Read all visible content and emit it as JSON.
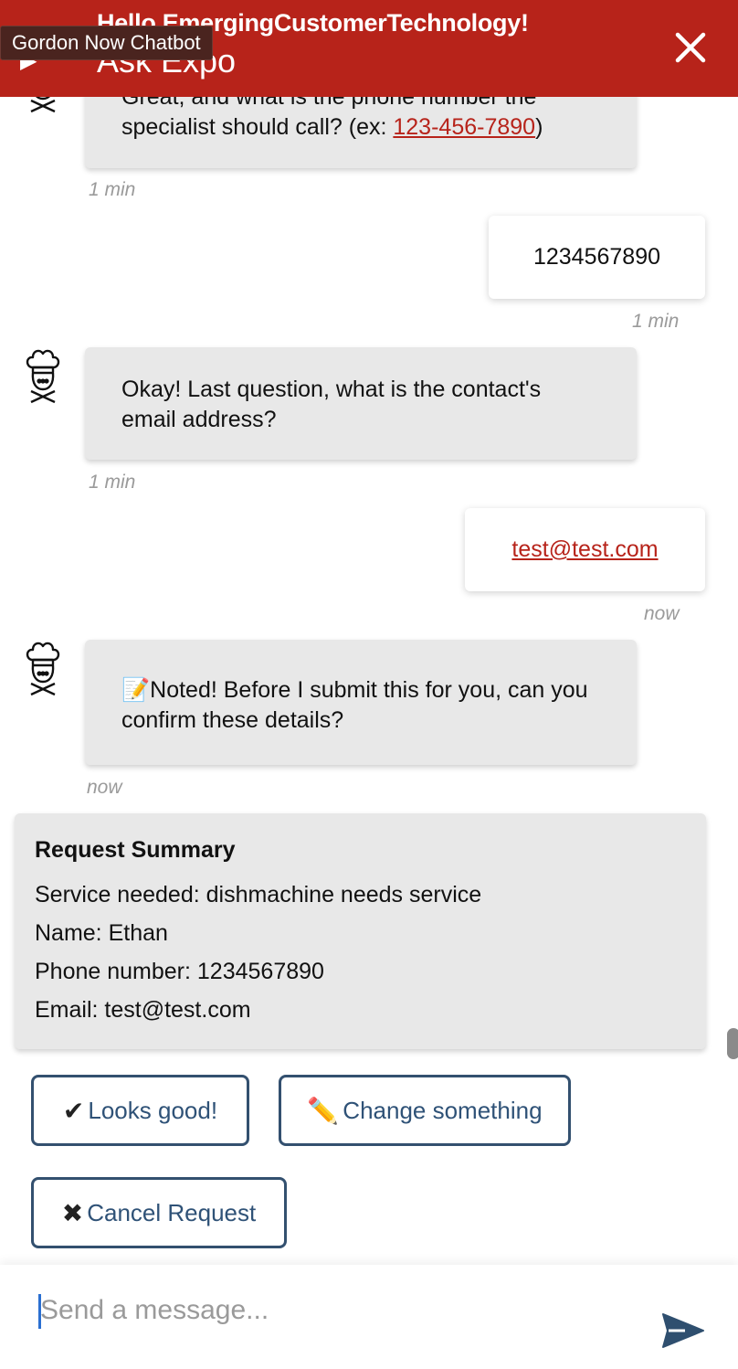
{
  "header": {
    "greeting": "Hello EmergingCustomerTechnology!",
    "title": "Ask Expo",
    "tooltip": "Gordon Now Chatbot",
    "brand_color": "#b7231a"
  },
  "messages": {
    "m1": {
      "prefix": "Great, and what is the phone number the specialist should call? (ex: ",
      "link": "123-456-7890",
      "suffix": ")",
      "time": "1 min"
    },
    "m2": {
      "text": "1234567890",
      "time": "1 min"
    },
    "m3": {
      "text": "Okay! Last question, what is the contact's email address?",
      "time": "1 min"
    },
    "m4": {
      "link": "test@test.com",
      "time": "now"
    },
    "m5": {
      "emoji": "📝",
      "text": "Noted! Before I submit this for you, can you confirm these details?",
      "time": "now"
    }
  },
  "summary": {
    "title": "Request Summary",
    "rows": [
      "Service needed: dishmachine needs service",
      "Name: Ethan",
      "Phone number: 1234567890",
      "Email: test@test.com"
    ]
  },
  "quick_replies": {
    "looks_good": {
      "icon": "✔",
      "label": "Looks good!"
    },
    "change": {
      "icon": "✏️",
      "label": "Change something"
    },
    "cancel": {
      "icon": "✖",
      "label": "Cancel Request"
    }
  },
  "composer": {
    "placeholder": "Send a message...",
    "send_icon": "send-icon"
  },
  "icons": {
    "avatar": "chef-avatar-icon",
    "close": "close-icon",
    "back": "back-arrow-icon"
  }
}
